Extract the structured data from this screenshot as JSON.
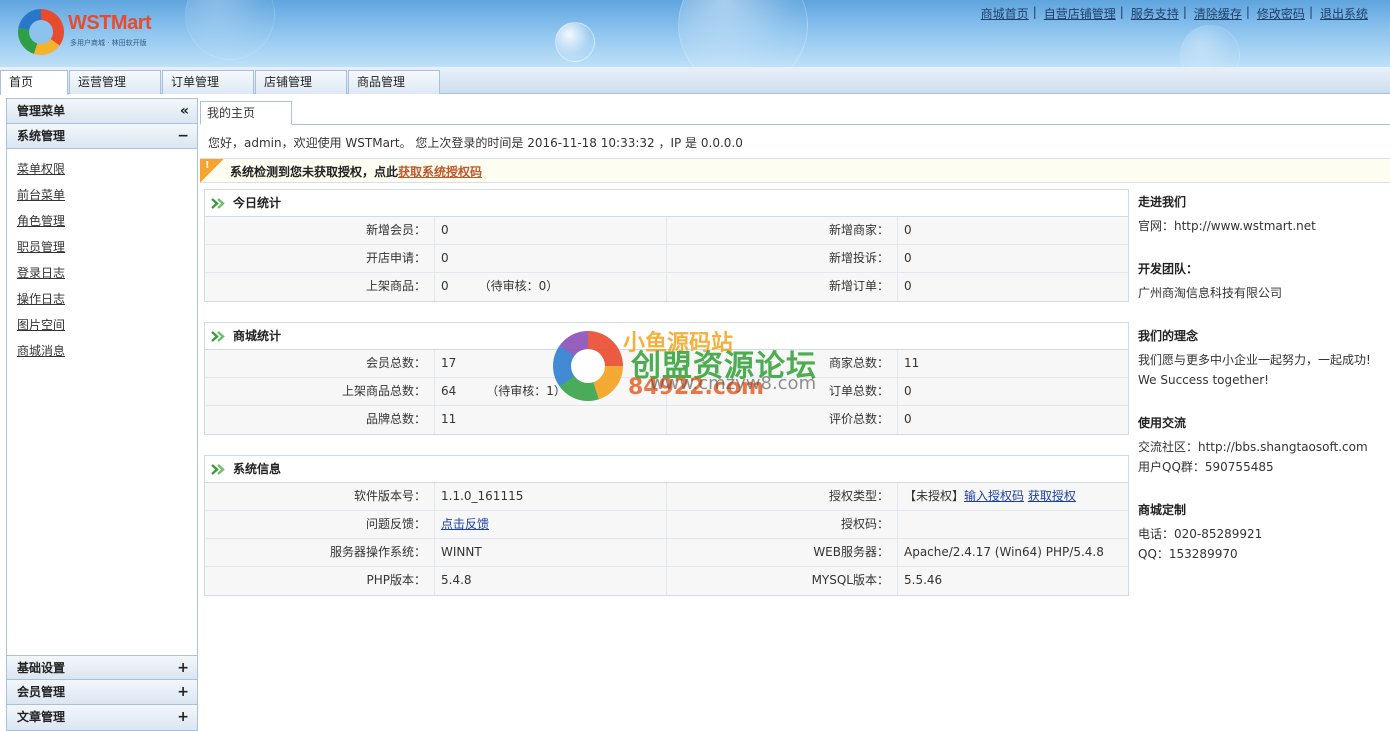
{
  "header": {
    "logo_title": "WSTMart",
    "logo_sub": "多用户商城 · 林田软开版",
    "links": [
      "商城首页",
      "自营店铺管理",
      "服务支持",
      "清除缓存",
      "修改密码",
      "退出系统"
    ],
    "separator": "|"
  },
  "nav": {
    "tabs": [
      "首页",
      "运营管理",
      "订单管理",
      "店铺管理",
      "商品管理"
    ]
  },
  "sidebar": {
    "title": "管理菜单",
    "collapse_glyph": "«",
    "section": "系统管理",
    "section_toggle": "−",
    "items": [
      "菜单权限",
      "前台菜单",
      "角色管理",
      "职员管理",
      "登录日志",
      "操作日志",
      "图片空间",
      "商城消息"
    ],
    "bottom": [
      {
        "label": "基础设置",
        "toggle": "+"
      },
      {
        "label": "会员管理",
        "toggle": "+"
      },
      {
        "label": "文章管理",
        "toggle": "+"
      }
    ]
  },
  "content": {
    "tab": "我的主页",
    "welcome": "您好，admin，欢迎使用 WSTMart。 您上次登录的时间是 2016-11-18 10:33:32 ，IP 是 0.0.0.0",
    "notice_text": "系统检测到您未获取授权，点此",
    "notice_link": "获取系统授权码"
  },
  "today": {
    "title": "今日统计",
    "rows": [
      {
        "l1": "新增会员：",
        "v1": "0",
        "l2": "新增商家：",
        "v2": "0"
      },
      {
        "l1": "开店申请：",
        "v1": "0",
        "l2": "新增投诉：",
        "v2": "0"
      },
      {
        "l1": "上架商品：",
        "v1": "0",
        "extra": "（待审核：0）",
        "l2": "新增订单：",
        "v2": "0"
      }
    ]
  },
  "mall": {
    "title": "商城统计",
    "rows": [
      {
        "l1": "会员总数：",
        "v1": "17",
        "l2": "商家总数：",
        "v2": "11"
      },
      {
        "l1": "上架商品总数：",
        "v1": "64",
        "extra": "（待审核：1）",
        "l2": "订单总数：",
        "v2": "0"
      },
      {
        "l1": "品牌总数：",
        "v1": "11",
        "l2": "评价总数：",
        "v2": "0"
      }
    ]
  },
  "sysinfo": {
    "title": "系统信息",
    "rows": [
      {
        "l1": "软件版本号：",
        "v1": "1.1.0_161115",
        "l2": "授权类型：",
        "v2_prefix": "【未授权】",
        "v2_link1": "输入授权码",
        "v2_link2": "获取授权"
      },
      {
        "l1": "问题反馈：",
        "v1_link": "点击反馈",
        "l2": "授权码：",
        "v2": ""
      },
      {
        "l1": "服务器操作系统：",
        "v1": "WINNT",
        "l2": "WEB服务器：",
        "v2": "Apache/2.4.17 (Win64) PHP/5.4.8"
      },
      {
        "l1": "PHP版本：",
        "v1": "5.4.8",
        "l2": "MYSQL版本：",
        "v2": "5.5.46"
      }
    ]
  },
  "info": {
    "about": {
      "title": "走进我们",
      "lines": [
        "官网：http://www.wstmart.net"
      ]
    },
    "team": {
      "title": "开发团队：",
      "lines": [
        "广州商淘信息科技有限公司"
      ]
    },
    "idea": {
      "title": "我们的理念",
      "lines": [
        "我们愿与更多中小企业一起努力，一起成功!",
        "We Success together!"
      ]
    },
    "exchange": {
      "title": "使用交流",
      "lines": [
        "交流社区：http://bbs.shangtaosoft.com",
        "用户QQ群：590755485"
      ]
    },
    "custom": {
      "title": "商城定制",
      "lines": [
        "电话：020-85289921",
        "QQ：153289970"
      ]
    }
  },
  "watermark": {
    "top": "小鱼源码站",
    "mid": "创盟资源论坛",
    "bot": "84922.com",
    "bot2": "www.cmzyw8.com"
  }
}
